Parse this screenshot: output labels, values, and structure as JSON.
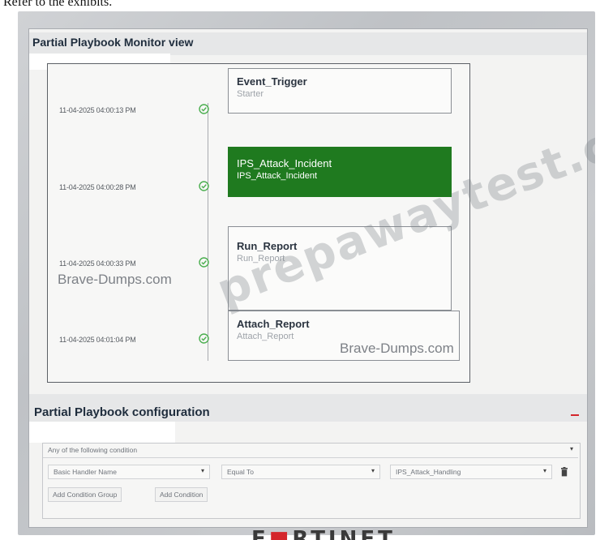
{
  "caption": "Refer to the exhibits.",
  "monitor": {
    "title": "Partial Playbook Monitor view",
    "steps": [
      {
        "timestamp": "11-04-2025 04:00:13 PM",
        "name": "Event_Trigger",
        "sub": "Starter",
        "active": false
      },
      {
        "timestamp": "11-04-2025 04:00:28 PM",
        "name": "IPS_Attack_Incident",
        "sub": "IPS_Attack_Incident",
        "active": true
      },
      {
        "timestamp": "11-04-2025 04:00:33 PM",
        "name": "Run_Report",
        "sub": "Run_Report",
        "active": false
      },
      {
        "timestamp": "11-04-2025 04:01:04 PM",
        "name": "Attach_Report",
        "sub": "Attach_Report",
        "active": false
      }
    ],
    "status_icon": "check-circle-icon"
  },
  "watermarks": {
    "brave_1": "Brave-Dumps.com",
    "brave_2": "Brave-Dumps.com",
    "prepaway": "prepawaytest.com"
  },
  "configuration": {
    "title": "Partial Playbook configuration",
    "condition_mode": "Any of the following condition",
    "field": "Basic Handler Name",
    "operator": "Equal To",
    "value": "IPS_Attack_Handling",
    "add_group_label": "Add Condition Group",
    "add_condition_label": "Add Condition",
    "delete_icon": "trash-icon"
  },
  "brand": {
    "logo_text_a": "F",
    "logo_text_b": "RTINET",
    "accent": "#1f7a1f",
    "logo_red": "#d4252b"
  }
}
